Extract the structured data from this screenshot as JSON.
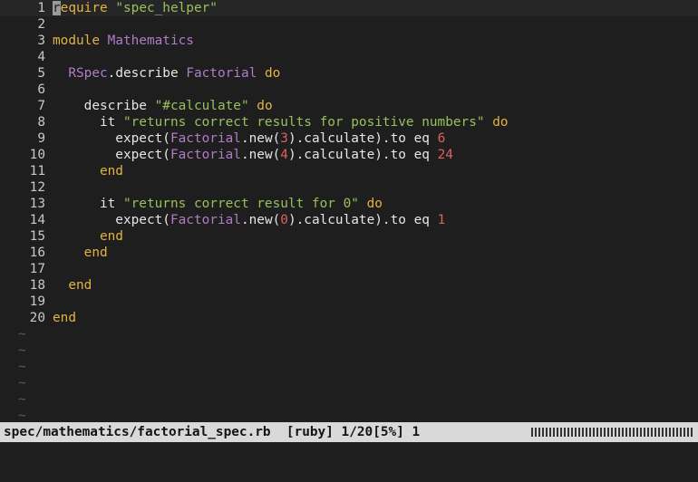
{
  "editor": {
    "lines": [
      {
        "num": "1",
        "segments": [
          [
            "kw",
            "require"
          ],
          [
            "plain",
            " "
          ],
          [
            "str",
            "\"spec_helper\""
          ]
        ]
      },
      {
        "num": "2",
        "segments": []
      },
      {
        "num": "3",
        "segments": [
          [
            "kw",
            "module"
          ],
          [
            "plain",
            " "
          ],
          [
            "const",
            "Mathematics"
          ]
        ]
      },
      {
        "num": "4",
        "segments": []
      },
      {
        "num": "5",
        "segments": [
          [
            "plain",
            "  "
          ],
          [
            "const",
            "RSpec"
          ],
          [
            "plain",
            ".describe "
          ],
          [
            "const",
            "Factorial"
          ],
          [
            "plain",
            " "
          ],
          [
            "kw",
            "do"
          ]
        ]
      },
      {
        "num": "6",
        "segments": []
      },
      {
        "num": "7",
        "segments": [
          [
            "plain",
            "    describe "
          ],
          [
            "str",
            "\"#calculate\""
          ],
          [
            "plain",
            " "
          ],
          [
            "kw",
            "do"
          ]
        ]
      },
      {
        "num": "8",
        "segments": [
          [
            "plain",
            "      it "
          ],
          [
            "str",
            "\"returns correct results for positive numbers\""
          ],
          [
            "plain",
            " "
          ],
          [
            "kw",
            "do"
          ]
        ]
      },
      {
        "num": "9",
        "segments": [
          [
            "plain",
            "        expect("
          ],
          [
            "const",
            "Factorial"
          ],
          [
            "plain",
            ".new("
          ],
          [
            "num",
            "3"
          ],
          [
            "plain",
            ").calculate).to eq "
          ],
          [
            "num",
            "6"
          ]
        ]
      },
      {
        "num": "10",
        "segments": [
          [
            "plain",
            "        expect("
          ],
          [
            "const",
            "Factorial"
          ],
          [
            "plain",
            ".new("
          ],
          [
            "num",
            "4"
          ],
          [
            "plain",
            ").calculate).to eq "
          ],
          [
            "num",
            "24"
          ]
        ]
      },
      {
        "num": "11",
        "segments": [
          [
            "plain",
            "      "
          ],
          [
            "kw",
            "end"
          ]
        ]
      },
      {
        "num": "12",
        "segments": []
      },
      {
        "num": "13",
        "segments": [
          [
            "plain",
            "      it "
          ],
          [
            "str",
            "\"returns correct result for 0\""
          ],
          [
            "plain",
            " "
          ],
          [
            "kw",
            "do"
          ]
        ]
      },
      {
        "num": "14",
        "segments": [
          [
            "plain",
            "        expect("
          ],
          [
            "const",
            "Factorial"
          ],
          [
            "plain",
            ".new("
          ],
          [
            "num",
            "0"
          ],
          [
            "plain",
            ").calculate).to eq "
          ],
          [
            "num",
            "1"
          ]
        ]
      },
      {
        "num": "15",
        "segments": [
          [
            "plain",
            "      "
          ],
          [
            "kw",
            "end"
          ]
        ]
      },
      {
        "num": "16",
        "segments": [
          [
            "plain",
            "    "
          ],
          [
            "kw",
            "end"
          ]
        ]
      },
      {
        "num": "17",
        "segments": []
      },
      {
        "num": "18",
        "segments": [
          [
            "plain",
            "  "
          ],
          [
            "kw",
            "end"
          ]
        ]
      },
      {
        "num": "19",
        "segments": []
      },
      {
        "num": "20",
        "segments": [
          [
            "kw",
            "end"
          ]
        ]
      }
    ],
    "tildes": [
      "~",
      "~",
      "~",
      "~",
      "~",
      "~"
    ],
    "cursor_char": "r"
  },
  "statusbar": {
    "text": "spec/mathematics/factorial_spec.rb  [ruby] 1/20[5%] 1"
  },
  "colors": {
    "background": "#1e1e1e",
    "keyword": "#e3b341",
    "string": "#98c15a",
    "constant": "#b07cc6",
    "number": "#e06060",
    "statusbar_bg": "#d9d9d9"
  }
}
